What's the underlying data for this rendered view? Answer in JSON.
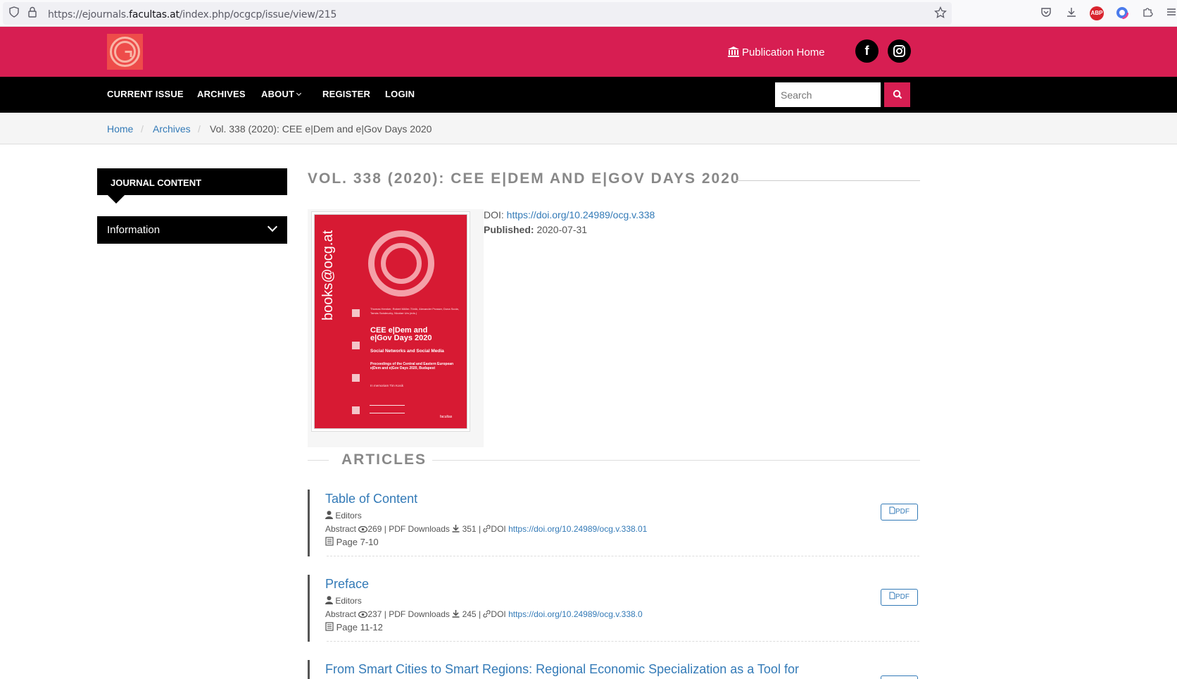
{
  "browser": {
    "url_prefix": "https://ejournals.",
    "url_domain": "facultas.at",
    "url_path": "/index.php/ocgcp/issue/view/215",
    "abp_label": "ABP"
  },
  "header": {
    "publication_home": "Publication Home",
    "facebook_glyph": "f",
    "instagram_glyph": "◎"
  },
  "nav": {
    "items": [
      "CURRENT ISSUE",
      "ARCHIVES",
      "ABOUT",
      "REGISTER",
      "LOGIN"
    ],
    "search_placeholder": "Search"
  },
  "breadcrumb": {
    "home": "Home",
    "archives": "Archives",
    "current": "Vol. 338 (2020): CEE e|Dem and e|Gov Days 2020",
    "separator": "/"
  },
  "sidebar": {
    "journal_content": "JOURNAL CONTENT",
    "information": "Information"
  },
  "issue": {
    "title": "VOL. 338 (2020): CEE E|DEM AND E|GOV DAYS 2020",
    "doi_label": "DOI:",
    "doi_url": "https://doi.org/10.24989/ocg.v.338",
    "published_label": "Published:",
    "published_date": "2020-07-31"
  },
  "cover": {
    "vertical_text": "books@ocg.at",
    "authors": "Thomas Hemker, Robert Müller-Török, Alexander Prosser, Dona Scola, Tamás Szádeczky, Nicolae Urs (eds.)",
    "title": "CEE e|Dem and e|Gov Days 2020",
    "subtitle": "Social Networks and Social Media",
    "proceedings": "Proceedings of the Central and Eastern European e|Dem and e|Gov Days 2020, Budapest",
    "memoriam": "In memoriam Tim Kosik",
    "publisher": "facultas"
  },
  "articles_heading": "ARTICLES",
  "articles": [
    {
      "title": "Table of Content",
      "authors": "Editors",
      "abstract_label": "Abstract",
      "abstract_views": "269",
      "pdf_downloads_label": "PDF Downloads",
      "pdf_downloads": "351",
      "doi_label": "DOI",
      "doi": "https://doi.org/10.24989/ocg.v.338.01",
      "pages": "Page 7-10",
      "pdf_button": "PDF"
    },
    {
      "title": "Preface",
      "authors": "Editors",
      "abstract_label": "Abstract",
      "abstract_views": "237",
      "pdf_downloads_label": "PDF Downloads",
      "pdf_downloads": "245",
      "doi_label": "DOI",
      "doi": "https://doi.org/10.24989/ocg.v.338.0",
      "pages": "Page 11-12",
      "pdf_button": "PDF"
    },
    {
      "title": "From Smart Cities to Smart Regions: Regional Economic Specialization as a Tool for",
      "pdf_button": ""
    }
  ]
}
